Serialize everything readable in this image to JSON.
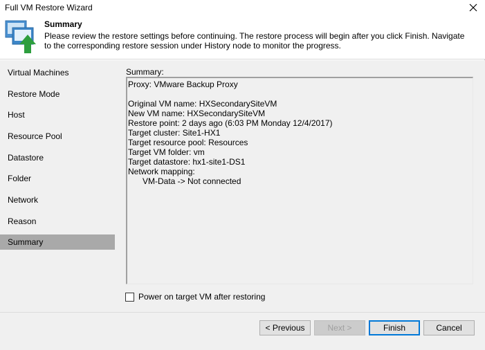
{
  "window": {
    "title": "Full VM Restore Wizard"
  },
  "header": {
    "title": "Summary",
    "description": "Please review the restore settings before continuing. The restore process will begin after you click Finish. Navigate to the corresponding restore session under History node to monitor the progress."
  },
  "nav": {
    "items": [
      {
        "label": "Virtual Machines"
      },
      {
        "label": "Restore Mode"
      },
      {
        "label": "Host"
      },
      {
        "label": "Resource Pool"
      },
      {
        "label": "Datastore"
      },
      {
        "label": "Folder"
      },
      {
        "label": "Network"
      },
      {
        "label": "Reason"
      },
      {
        "label": "Summary"
      }
    ],
    "selected": "Summary"
  },
  "summary": {
    "label": "Summary:",
    "lines": [
      "Proxy: VMware Backup Proxy",
      "",
      "Original VM name: HXSecondarySiteVM",
      "New VM name: HXSecondarySiteVM",
      "Restore point: 2 days ago (6:03 PM Monday 12/4/2017)",
      "Target cluster: Site1-HX1",
      "Target resource pool: Resources",
      "Target VM folder: vm",
      "Target datastore: hx1-site1-DS1",
      "Network mapping:",
      "VM-Data -> Not connected"
    ]
  },
  "options": {
    "power_on_label": "Power on target VM after restoring",
    "power_on_checked": false
  },
  "buttons": {
    "previous": "< Previous",
    "next": "Next >",
    "finish": "Finish",
    "cancel": "Cancel"
  },
  "colors": {
    "panel_bg": "#f0f0f0",
    "selected_nav_bg": "#a9a9a9",
    "primary_border": "#0078d7",
    "icon_green": "#2e9e3e",
    "icon_blue": "#2f7fc0"
  }
}
